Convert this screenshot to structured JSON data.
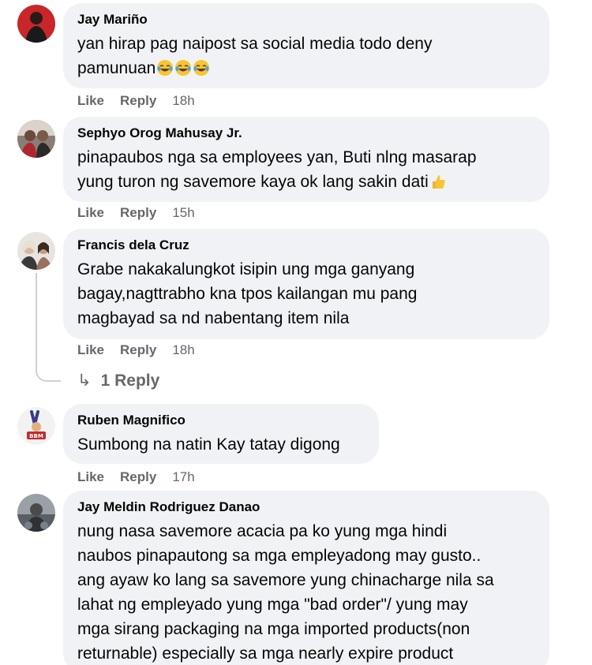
{
  "comments": [
    {
      "author": "Jay Mariño",
      "text": "yan hirap pag naipost sa social media todo deny",
      "text2": "pamunuan",
      "emojis": [
        "crying-laughing-emoji",
        "crying-laughing-emoji",
        "crying-laughing-emoji"
      ],
      "like": "Like",
      "reply": "Reply",
      "time": "18h"
    },
    {
      "author": "Sephyo Orog Mahusay Jr.",
      "text": "pinapaubos nga sa employees yan, Buti nlng masarap\nyung turon ng savemore kaya ok lang sakin dati",
      "emojis": [
        "thumbs-up-emoji"
      ],
      "like": "Like",
      "reply": "Reply",
      "time": "15h"
    },
    {
      "author": "Francis dela Cruz",
      "text": "Grabe nakakalungkot isipin ung mga ganyang\nbagay,nagttrabho kna tpos kailangan mu pang\nmagbayad sa nd nabentang item nila",
      "like": "Like",
      "reply": "Reply",
      "time": "18h",
      "replies_label": "1 Reply"
    },
    {
      "author": "Ruben Magnifico",
      "text": "Sumbong na natin Kay tatay digong",
      "like": "Like",
      "reply": "Reply",
      "time": "17h"
    },
    {
      "author": "Jay Meldin Rodriguez Danao",
      "text": "nung nasa savemore acacia pa ko yung mga hindi\nnaubos pinapautong sa mga empleyadong may gusto..\nang ayaw ko lang sa savemore yung chinacharge nila sa\nlahat ng empleyado yung mga \"bad order\"/ yung may\nmga sirang packaging na mga imported products(non\nreturnable) especially sa mga nearly expire product"
    }
  ],
  "colors": {
    "bubble": "#f0f2f5",
    "meta": "#65676b",
    "text": "#050505",
    "thread": "#ced0d4"
  }
}
